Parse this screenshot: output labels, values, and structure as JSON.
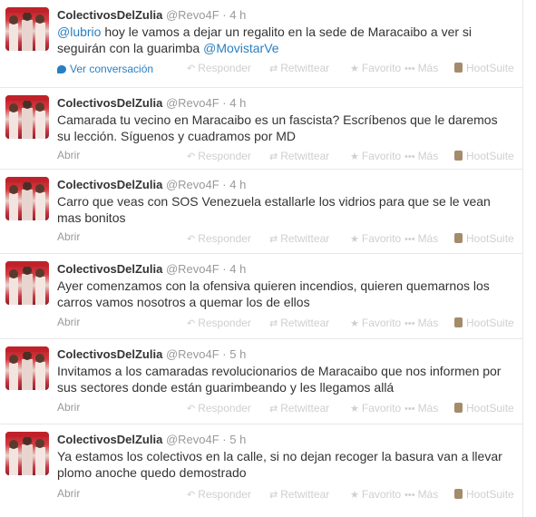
{
  "tweets": [
    {
      "fullname": "ColectivosDelZulia",
      "username": "@Revo4F",
      "dot": "·",
      "time": "4 h",
      "mention1": "@lubrio",
      "text": " hoy le vamos a dejar un regalito en la sede de Maracaibo a ver si seguirán con la guarimba ",
      "mention2": "@MovistarVe",
      "expand": "Ver conversación"
    },
    {
      "fullname": "ColectivosDelZulia",
      "username": "@Revo4F",
      "dot": "·",
      "time": "4 h",
      "text": "Camarada tu vecino en Maracaibo es un fascista? Escríbenos que le daremos su lección. Síguenos y cuadramos por MD",
      "expand": "Abrir"
    },
    {
      "fullname": "ColectivosDelZulia",
      "username": "@Revo4F",
      "dot": "·",
      "time": "4 h",
      "text": "Carro que veas con SOS Venezuela estallarle los vidrios para que se le vean mas bonitos",
      "expand": "Abrir"
    },
    {
      "fullname": "ColectivosDelZulia",
      "username": "@Revo4F",
      "dot": "·",
      "time": "4 h",
      "text": "Ayer comenzamos con la ofensiva quieren incendios, quieren quemarnos los carros vamos nosotros a quemar los de ellos",
      "expand": "Abrir"
    },
    {
      "fullname": "ColectivosDelZulia",
      "username": "@Revo4F",
      "dot": "·",
      "time": "5 h",
      "text": "Invitamos a los camaradas revolucionarios de Maracaibo que nos informen por sus sectores donde están guarimbeando y les llegamos allá",
      "expand": "Abrir"
    },
    {
      "fullname": "ColectivosDelZulia",
      "username": "@Revo4F",
      "dot": "·",
      "time": "5 h",
      "text": "Ya estamos los colectivos en la calle, si no dejan recoger la basura van a llevar plomo anoche quedo demostrado",
      "expand": "Abrir"
    }
  ],
  "actions": {
    "reply": "Responder",
    "retweet": "Retwittear",
    "favorite": "Favorito",
    "more": "Más",
    "hootsuite": "HootSuite"
  },
  "icons": {
    "reply": "reply-icon",
    "retweet": "retweet-icon",
    "favorite": "star-icon",
    "more": "more-dots-icon",
    "hootsuite": "hootsuite-icon",
    "conversation": "conversation-icon"
  },
  "colors": {
    "link": "#2a7fc1",
    "muted": "#999999",
    "action": "#cfcfcf",
    "text": "#333333"
  }
}
